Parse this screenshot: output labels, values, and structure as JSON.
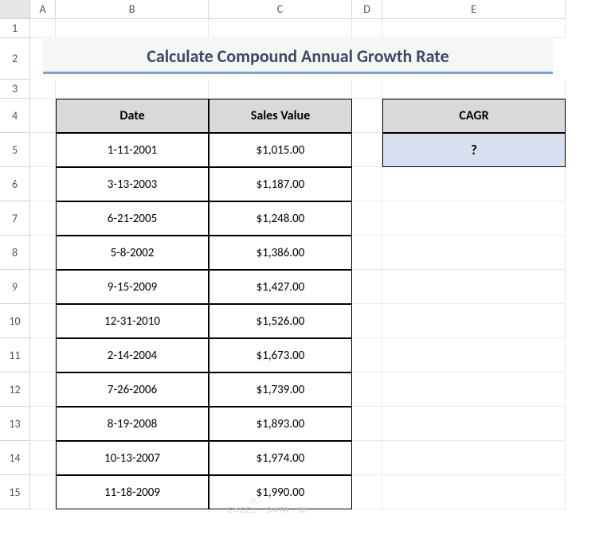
{
  "columns": [
    "A",
    "B",
    "C",
    "D",
    "E"
  ],
  "rows": [
    "1",
    "2",
    "3",
    "4",
    "5",
    "6",
    "7",
    "8",
    "9",
    "10",
    "11",
    "12",
    "13",
    "14",
    "15"
  ],
  "title": "Calculate Compound Annual Growth Rate",
  "table": {
    "headers": {
      "date": "Date",
      "sales": "Sales Value"
    },
    "data": [
      {
        "date": "1-11-2001",
        "sales": "$1,015.00"
      },
      {
        "date": "3-13-2003",
        "sales": "$1,187.00"
      },
      {
        "date": "6-21-2005",
        "sales": "$1,248.00"
      },
      {
        "date": "5-8-2002",
        "sales": "$1,386.00"
      },
      {
        "date": "9-15-2009",
        "sales": "$1,427.00"
      },
      {
        "date": "12-31-2010",
        "sales": "$1,526.00"
      },
      {
        "date": "2-14-2004",
        "sales": "$1,673.00"
      },
      {
        "date": "7-26-2006",
        "sales": "$1,739.00"
      },
      {
        "date": "8-19-2008",
        "sales": "$1,893.00"
      },
      {
        "date": "10-13-2007",
        "sales": "$1,974.00"
      },
      {
        "date": "11-18-2009",
        "sales": "$1,990.00"
      }
    ]
  },
  "cagr": {
    "header": "CAGR",
    "value": "?"
  },
  "watermark": "EXCEL · DATA · BI"
}
